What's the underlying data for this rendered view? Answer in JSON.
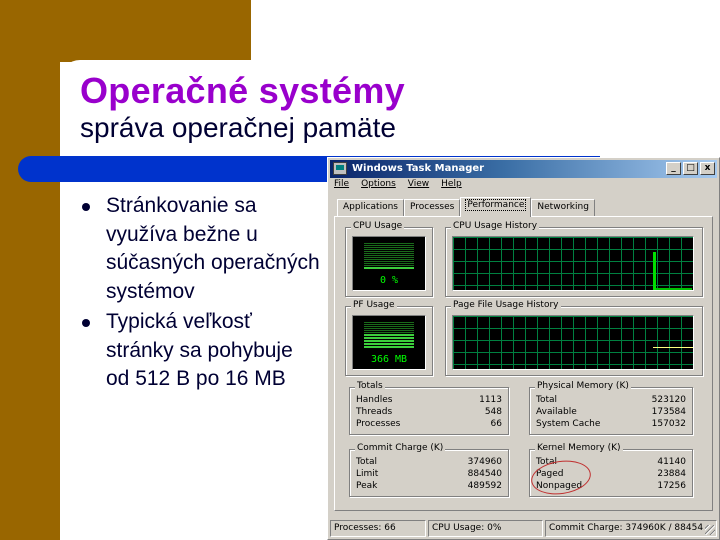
{
  "slide": {
    "title": "Operačné systémy",
    "subtitle": "správa operačnej pamäte",
    "bullets": [
      "Stránkovanie sa využíva bežne  u súčasných operačných systémov",
      "Typická veľkosť stránky sa pohybuje od 512 B po 16 MB"
    ],
    "colors": {
      "brown": "#996600",
      "blue_bar": "#0033cc",
      "title": "#9900cc"
    }
  },
  "task_manager": {
    "window_title": "Windows Task Manager",
    "title_buttons": {
      "minimize": "_",
      "maximize": "□",
      "close": "x"
    },
    "menu": [
      "File",
      "Options",
      "View",
      "Help"
    ],
    "tabs": [
      {
        "label": "Applications",
        "active": false
      },
      {
        "label": "Processes",
        "active": false
      },
      {
        "label": "Performance",
        "active": true
      },
      {
        "label": "Networking",
        "active": false
      }
    ],
    "cpu_usage": {
      "label": "CPU Usage",
      "value": "0 %",
      "percent": 0
    },
    "cpu_history": {
      "label": "CPU Usage History"
    },
    "pf_usage": {
      "label": "PF Usage",
      "value": "366 MB"
    },
    "pf_history": {
      "label": "Page File Usage History"
    },
    "totals": {
      "label": "Totals",
      "rows": [
        {
          "name": "Handles",
          "value": "1113"
        },
        {
          "name": "Threads",
          "value": "548"
        },
        {
          "name": "Processes",
          "value": "66"
        }
      ]
    },
    "physical_memory": {
      "label": "Physical Memory (K)",
      "rows": [
        {
          "name": "Total",
          "value": "523120"
        },
        {
          "name": "Available",
          "value": "173584"
        },
        {
          "name": "System Cache",
          "value": "157032"
        }
      ]
    },
    "commit_charge": {
      "label": "Commit Charge (K)",
      "rows": [
        {
          "name": "Total",
          "value": "374960"
        },
        {
          "name": "Limit",
          "value": "884540"
        },
        {
          "name": "Peak",
          "value": "489592"
        }
      ]
    },
    "kernel_memory": {
      "label": "Kernel Memory (K)",
      "rows": [
        {
          "name": "Total",
          "value": "41140"
        },
        {
          "name": "Paged",
          "value": "23884"
        },
        {
          "name": "Nonpaged",
          "value": "17256"
        }
      ]
    },
    "status_bar": {
      "processes": "Processes: 66",
      "cpu": "CPU Usage: 0%",
      "commit": "Commit Charge: 374960K / 88454"
    }
  }
}
